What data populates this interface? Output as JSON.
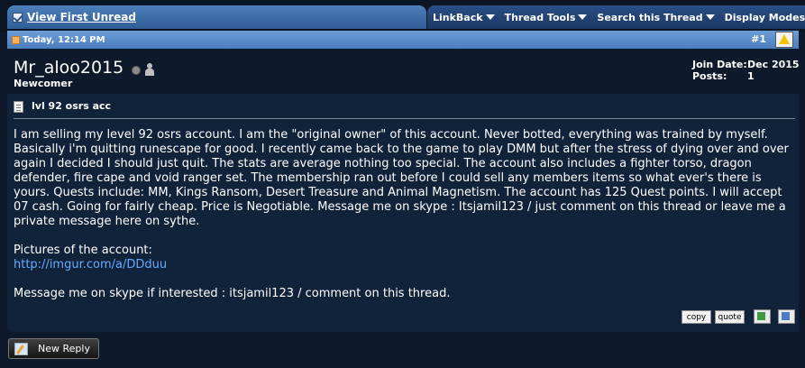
{
  "toolbar": {
    "view_first_unread": "View First Unread",
    "menu": [
      "LinkBack",
      "Thread Tools",
      "Search this Thread",
      "Display Modes"
    ]
  },
  "post": {
    "date": "Today, 12:14 PM",
    "number": "#1",
    "username": "Mr_aloo2015",
    "user_title": "Newcomer",
    "join_date_label": "Join Date:",
    "join_date_value": "Dec 2015",
    "posts_label": "Posts:",
    "posts_value": "1",
    "title": "lvl 92 osrs acc",
    "body_paragraph": "I am selling my level 92 osrs account. I am the \"original owner\" of this account. Never botted, everything was trained by myself. Basically i'm quitting runescape for good. I recently came back to the game to play DMM but after the stress of dying over and over again I decided I should just quit. The stats are average nothing too special. The account also includes a fighter torso, dragon defender, fire cape and void ranger set. The membership ran out before I could sell any members items so what ever's there is yours. Quests include: MM, Kings Ransom, Desert Treasure and Animal Magnetism. The account has 125 Quest points. I will accept 07 cash. Going for fairly cheap. Price is Negotiable. Message me on skype : Itsjamil123 / just comment on this thread or leave me a private message here on sythe.",
    "pictures_label": "Pictures of the account:",
    "pictures_link": "http://imgur.com/a/DDduu",
    "closing_line": "Message me on skype if interested : itsjamil123 / comment on this thread."
  },
  "actions": {
    "copy": "copy",
    "quote": "quote",
    "new_reply": "New Reply"
  },
  "colors": {
    "page_bg": "#0e1a2b",
    "post_bg": "#11233a",
    "header_blue": "#4a7dbd",
    "link": "#66aaff"
  },
  "icons": [
    "checkbox-icon",
    "chevron-down-icon",
    "post-icon",
    "warning-icon",
    "offline-status-icon",
    "user-icon",
    "document-icon",
    "multiquote-icon",
    "quick-reply-icon",
    "pencil-icon"
  ]
}
